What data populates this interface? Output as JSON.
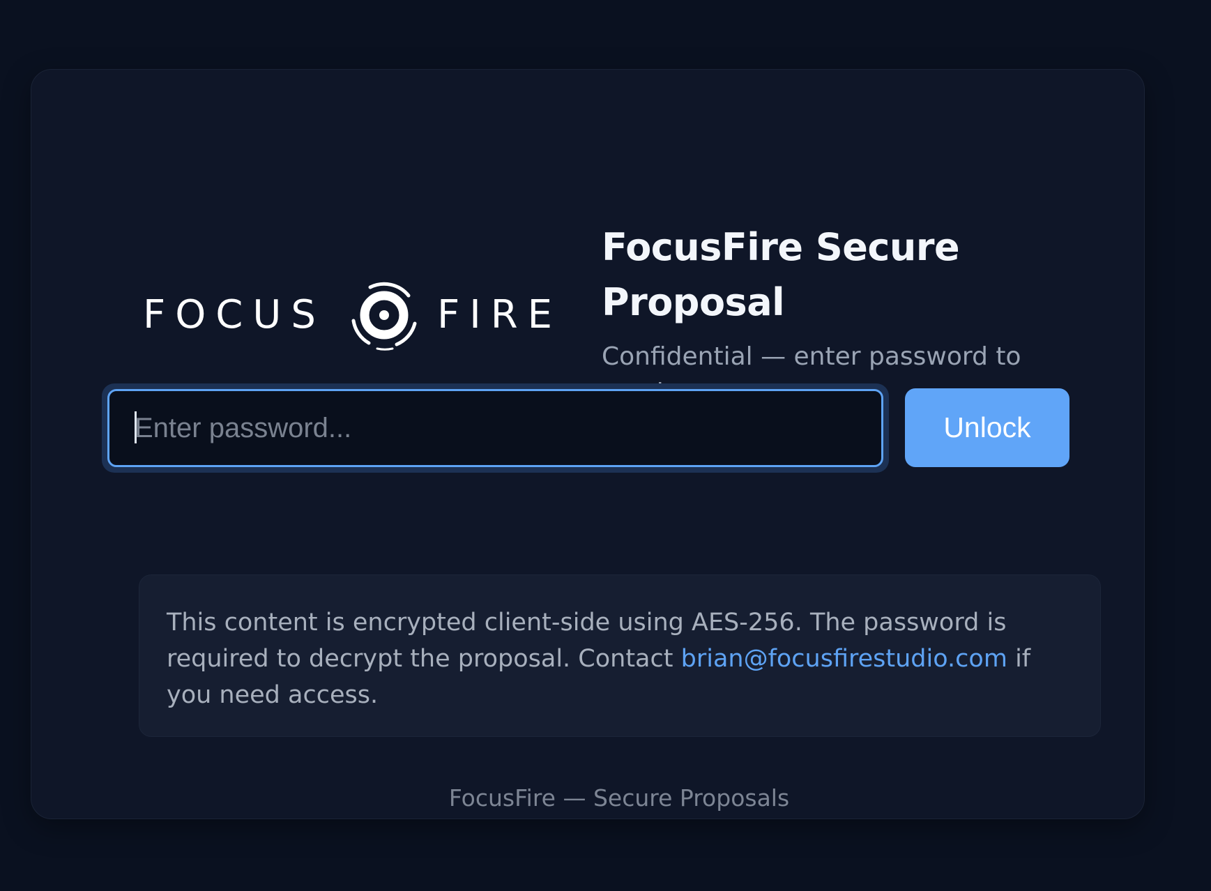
{
  "brand": {
    "logo_word_left": "FOCUS",
    "logo_word_right": "FIRE",
    "logo_icon": "target-reticle-icon"
  },
  "header": {
    "title": "FocusFire Secure Proposal",
    "subtitle": "Confidential — enter password to continue."
  },
  "password": {
    "placeholder": "Enter password...",
    "value": ""
  },
  "unlock": {
    "label": "Unlock"
  },
  "notice": {
    "text_before": "This content is encrypted client-side using AES-256. The password is required to decrypt the proposal. Contact ",
    "email": "brian@focusfirestudio.com",
    "text_after": " if you need access."
  },
  "footer": {
    "text": "FocusFire — Secure Proposals"
  },
  "colors": {
    "background": "#0a1120",
    "card": "#0f1628",
    "accent": "#60a5f8",
    "link": "#5ea3f4",
    "title": "#f3f6fb",
    "muted_text": "#9aa4b4"
  }
}
